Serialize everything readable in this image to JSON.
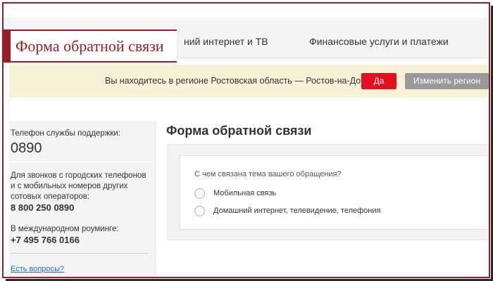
{
  "nav": {
    "internet_tv": "ний интернет и ТВ",
    "finance": "Финансовые услуги и платежи"
  },
  "banner": {
    "title": "Форма обратной связи"
  },
  "region": {
    "question": "Вы находитесь в регионе Ростовская область — Ростов-на-Дону?",
    "yes_label": "Да",
    "change_label": "Изменить регион"
  },
  "sidebar": {
    "support_label": "Телефон службы поддержки:",
    "support_phone": "0890",
    "city_label": "Для звонков с городских телефонов и с мобильных номеров других сотовых операторов:",
    "city_phone": "8 800 250 0890",
    "roaming_label": "В международном роуминге:",
    "roaming_phone": "+7 495 766 0166",
    "questions_link": "Есть вопросы?"
  },
  "form": {
    "heading": "Форма обратной связи",
    "question": "С чем связана тема вашего обращения?",
    "options": [
      {
        "label": "Мобильная связь",
        "selected": false
      },
      {
        "label": "Домашний интернет, телевидение, телефония",
        "selected": false
      }
    ]
  },
  "colors": {
    "brand_red": "#e3101f",
    "banner_red": "#9b1c22",
    "region_bg": "#f7f1d7",
    "link": "#2a6bb8"
  }
}
